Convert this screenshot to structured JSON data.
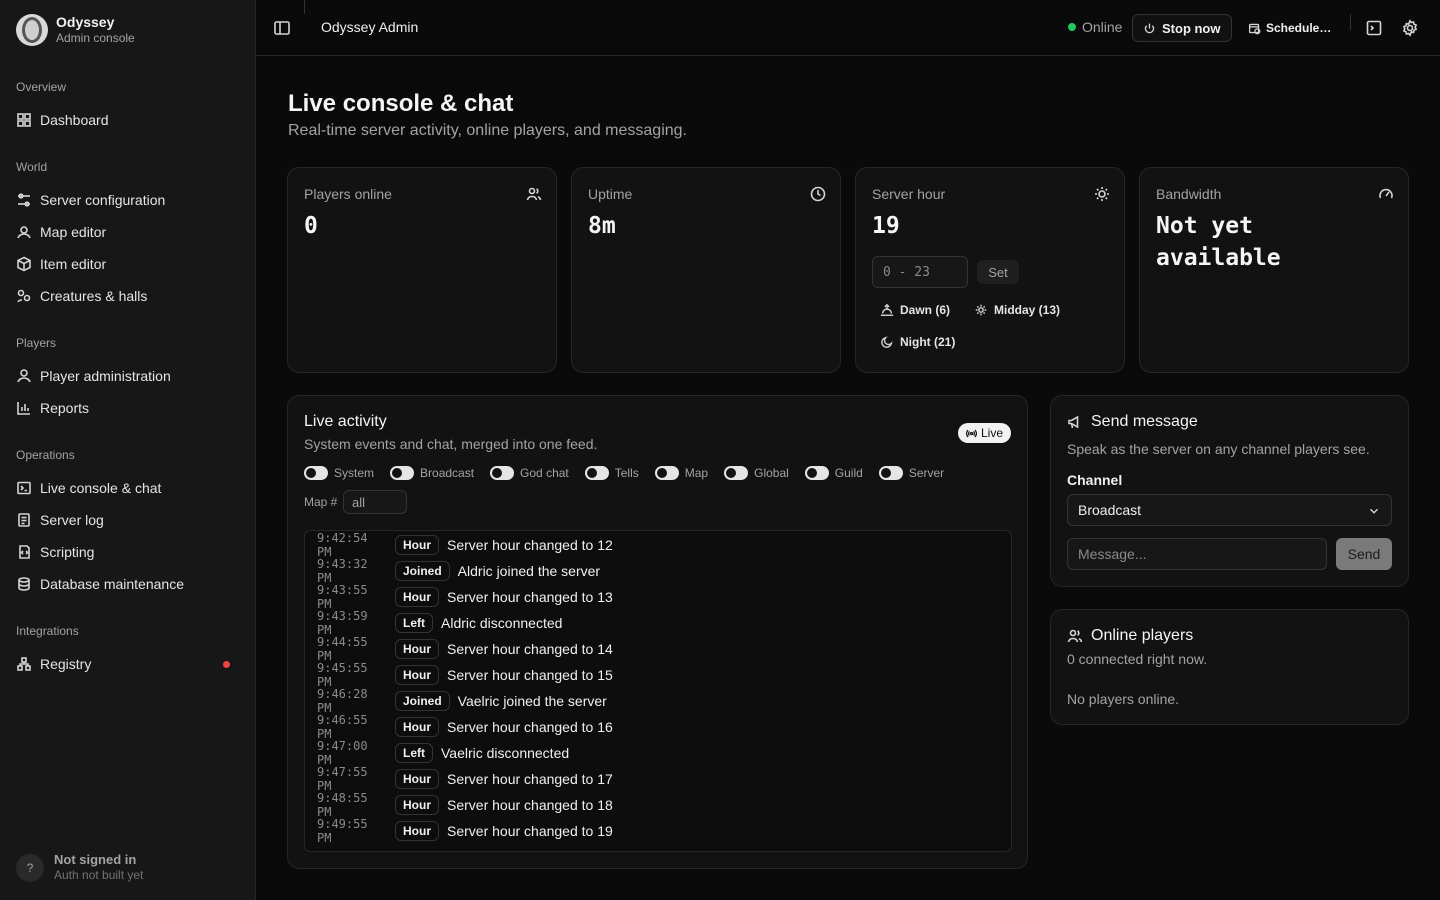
{
  "brand": {
    "name": "Odyssey",
    "subtitle": "Admin console"
  },
  "nav": {
    "groups": [
      {
        "title": "Overview",
        "items": [
          {
            "label": "Dashboard",
            "icon": "dashboard-icon"
          }
        ]
      },
      {
        "title": "World",
        "items": [
          {
            "label": "Server configuration",
            "icon": "sliders-icon"
          },
          {
            "label": "Map editor",
            "icon": "map-pin-icon"
          },
          {
            "label": "Item editor",
            "icon": "box-icon"
          },
          {
            "label": "Creatures & halls",
            "icon": "creatures-icon"
          }
        ]
      },
      {
        "title": "Players",
        "items": [
          {
            "label": "Player administration",
            "icon": "user-icon"
          },
          {
            "label": "Reports",
            "icon": "bar-chart-icon"
          }
        ]
      },
      {
        "title": "Operations",
        "items": [
          {
            "label": "Live console & chat",
            "icon": "terminal-icon"
          },
          {
            "label": "Server log",
            "icon": "log-icon"
          },
          {
            "label": "Scripting",
            "icon": "script-icon"
          },
          {
            "label": "Database maintenance",
            "icon": "database-icon"
          }
        ]
      },
      {
        "title": "Integrations",
        "items": [
          {
            "label": "Registry",
            "icon": "network-icon",
            "alert": true
          }
        ]
      }
    ],
    "alert_color": "#ef4444"
  },
  "account": {
    "avatar": "?",
    "name": "Not signed in",
    "sub": "Auth not built yet"
  },
  "header": {
    "title": "Odyssey Admin",
    "status": "Online",
    "status_color": "#22c55e",
    "stop_label": "Stop now",
    "schedule_label": "Schedule…"
  },
  "page": {
    "title": "Live console & chat",
    "subtitle": "Real-time server activity, online players, and messaging."
  },
  "stats": {
    "players": {
      "label": "Players online",
      "value": "0"
    },
    "uptime": {
      "label": "Uptime",
      "value": "8m"
    },
    "hour": {
      "label": "Server hour",
      "value": "19",
      "input_placeholder": "0 - 23",
      "set_label": "Set",
      "presets": [
        "Dawn (6)",
        "Midday (13)",
        "Night (21)"
      ]
    },
    "bandwidth": {
      "label": "Bandwidth",
      "value": "Not yet available"
    }
  },
  "activity": {
    "title": "Live activity",
    "subtitle": "System events and chat, merged into one feed.",
    "badge": "Live",
    "filters": [
      "System",
      "Broadcast",
      "God chat",
      "Tells",
      "Map",
      "Global",
      "Guild",
      "Server"
    ],
    "map_label": "Map #",
    "map_value": "all",
    "rows": [
      {
        "time": "9:42:54 PM",
        "tag": "Hour",
        "text": "Server hour changed to 12"
      },
      {
        "time": "9:43:32 PM",
        "tag": "Joined",
        "text": "Aldric joined the server"
      },
      {
        "time": "9:43:55 PM",
        "tag": "Hour",
        "text": "Server hour changed to 13"
      },
      {
        "time": "9:43:59 PM",
        "tag": "Left",
        "text": "Aldric disconnected"
      },
      {
        "time": "9:44:55 PM",
        "tag": "Hour",
        "text": "Server hour changed to 14"
      },
      {
        "time": "9:45:55 PM",
        "tag": "Hour",
        "text": "Server hour changed to 15"
      },
      {
        "time": "9:46:28 PM",
        "tag": "Joined",
        "text": "Vaelric joined the server"
      },
      {
        "time": "9:46:55 PM",
        "tag": "Hour",
        "text": "Server hour changed to 16"
      },
      {
        "time": "9:47:00 PM",
        "tag": "Left",
        "text": "Vaelric disconnected"
      },
      {
        "time": "9:47:55 PM",
        "tag": "Hour",
        "text": "Server hour changed to 17"
      },
      {
        "time": "9:48:55 PM",
        "tag": "Hour",
        "text": "Server hour changed to 18"
      },
      {
        "time": "9:49:55 PM",
        "tag": "Hour",
        "text": "Server hour changed to 19"
      }
    ]
  },
  "send": {
    "title": "Send message",
    "subtitle": "Speak as the server on any channel players see.",
    "channel_label": "Channel",
    "channel_value": "Broadcast",
    "message_placeholder": "Message...",
    "send_label": "Send"
  },
  "online": {
    "title": "Online players",
    "subtitle": "0 connected right now.",
    "empty": "No players online."
  }
}
